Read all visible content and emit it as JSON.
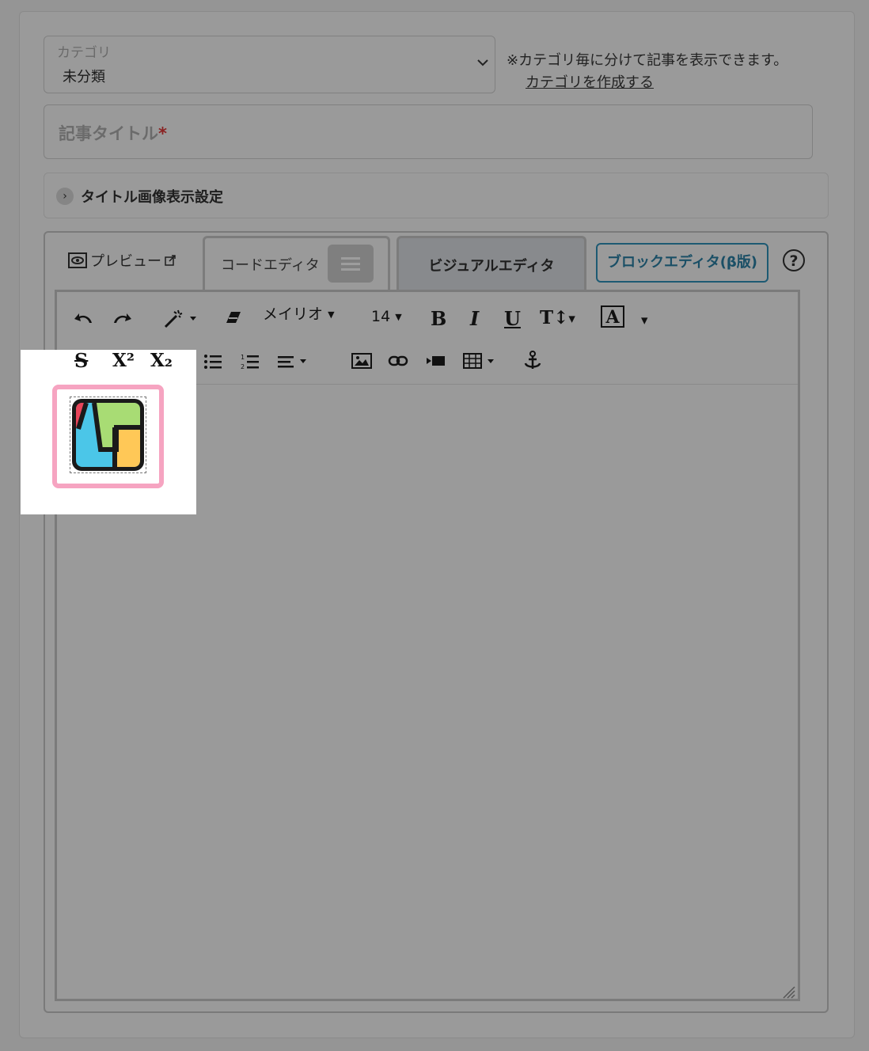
{
  "category": {
    "label": "カテゴリ",
    "value": "未分類",
    "note": "※カテゴリ毎に分けて記事を表示できます。",
    "create_link": "カテゴリを作成する"
  },
  "title_field": {
    "placeholder": "記事タイトル",
    "required_mark": "*"
  },
  "accordion": {
    "label": "タイトル画像表示設定"
  },
  "tabs": {
    "preview": "プレビュー",
    "code": "コードエディタ",
    "visual": "ビジュアルエディタ",
    "block": "ブロックエディタ(β版)",
    "help": "?"
  },
  "toolbar": {
    "font_name": "メイリオ",
    "font_size": "14",
    "bold": "B",
    "italic": "I",
    "underline": "U",
    "text_size": "T↕",
    "color": "A",
    "strike": "S",
    "superscript": "X²",
    "subscript": "X₂"
  },
  "colors": {
    "highlight": "#f6a4c1",
    "block_tab": "#1d5a73",
    "logo_green": "#a8dc74",
    "logo_yellow": "#ffc857",
    "logo_blue": "#4bc6e8",
    "logo_red": "#e8455a"
  }
}
